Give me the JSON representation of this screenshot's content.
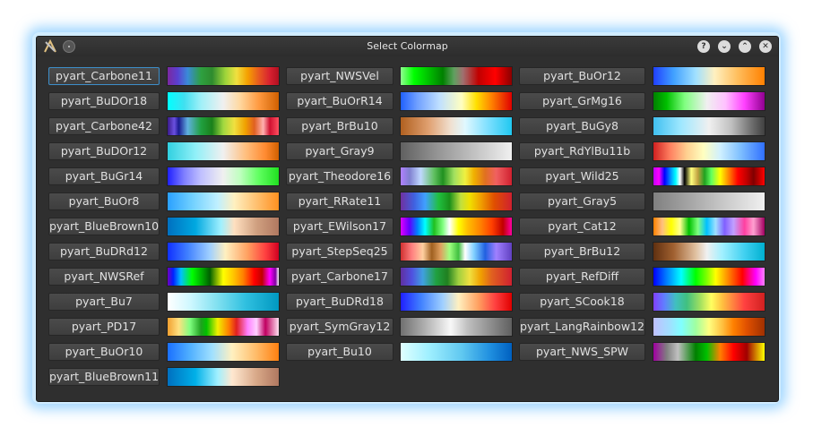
{
  "window": {
    "title": "Select Colormap",
    "buttons": {
      "help": "?",
      "minimize": "⌄",
      "maximize": "⌃",
      "close": "✕"
    }
  },
  "columns": [
    [
      {
        "name": "pyart_Carbone11",
        "gradient": "linear-gradient(90deg,#7b28a0 0%,#5a40d0 9%,#3a8ad8 18%,#2ea040 30%,#2e8b2e 40%,#9dd43a 52%,#f0e040 62%,#f5a000 72%,#e85a20 82%,#d82030 92%,#b01020 100%)"
      },
      {
        "name": "pyart_BuDOr18",
        "gradient": "linear-gradient(90deg,#00ffff 0%,#40e0f0 15%,#a0f0f8 30%,#f0f0f0 50%,#ffd8a0 65%,#ff9a40 82%,#d06000 100%)"
      },
      {
        "name": "pyart_Carbone42",
        "gradient": "linear-gradient(90deg,#3a1a8a 0%,#6a50e0 6%,#1a1a90 10%,#60b0e0 18%,#20a040 30%,#1a801a 40%,#a0d840 50%,#f0e040 60%,#f0a000 70%,#e06020 78%,#ffb0b0 86%,#d01030 92%,#ff5060 100%)"
      },
      {
        "name": "pyart_BuDOr12",
        "gradient": "linear-gradient(90deg,#30d0e0 0%,#90f0f8 25%,#f0f0f0 50%,#ffc080 70%,#ff8a30 88%,#d06000 100%)"
      },
      {
        "name": "pyart_BuGr14",
        "gradient": "linear-gradient(90deg,#2020ff 0%,#8080ff 15%,#c0c0ff 30%,#f0f0f0 50%,#c0ffc0 65%,#60ff60 82%,#20e020 100%)"
      },
      {
        "name": "pyart_BuOr8",
        "gradient": "linear-gradient(90deg,#2aa0ff 0%,#70d0ff 22%,#c0f0ff 45%,#fff0c0 60%,#ffc070 80%,#ff9020 100%)"
      },
      {
        "name": "pyart_BlueBrown10",
        "gradient": "linear-gradient(90deg,#0070c0 0%,#00a8e0 25%,#a0f0ff 48%,#ffe0c0 60%,#d0a080 80%,#b07860 100%)"
      },
      {
        "name": "pyart_BuDRd12",
        "gradient": "linear-gradient(90deg,#1030ff 0%,#4080ff 18%,#a0d0ff 38%,#fff0c0 52%,#ffa060 72%,#ff4040 88%,#d00020 100%)"
      },
      {
        "name": "pyart_NWSRef",
        "gradient": "linear-gradient(90deg,#7000c0 0%,#0020ff 5%,#00c0ff 12%,#00ff00 22%,#00a000 32%,#006000 38%,#ffff00 50%,#ffc000 60%,#ff8000 68%,#ff0000 78%,#c00000 85%,#ff00ff 92%,#8000a0 97%,#ffffff 100%)"
      },
      {
        "name": "pyart_Bu7",
        "gradient": "linear-gradient(90deg,#ffffff 0%,#d0f8ff 20%,#80e0f0 45%,#30c0e0 70%,#0098c0 100%)"
      },
      {
        "name": "pyart_PD17",
        "gradient": "linear-gradient(90deg,#f0a030 0%,#ffe080 10%,#80ff80 20%,#20a020 30%,#00c000 35%,#f0f000 45%,#ff8000 55%,#e02020 62%,#ff80ff 72%,#ffd0ff 80%,#c00060 88%,#ffe0f0 100%)"
      },
      {
        "name": "pyart_BuOr10",
        "gradient": "linear-gradient(90deg,#1a70ff 0%,#50b0ff 20%,#a0e0ff 40%,#fff0c0 58%,#ffc070 78%,#ff8010 100%)"
      },
      {
        "name": "pyart_BlueBrown11",
        "gradient": "linear-gradient(90deg,#0070c0 0%,#00b0e8 25%,#a0f0ff 45%,#ffe8d0 58%,#d8a888 80%,#b07860 100%)"
      }
    ],
    [
      {
        "name": "pyart_NWSVel",
        "gradient": "linear-gradient(90deg,#90ff90 0%,#00ff00 12%,#00c000 25%,#008000 38%,#60a060 48%,#a07070 56%,#c00000 70%,#ff0000 85%,#8a0000 100%)"
      },
      {
        "name": "pyart_BuOrR14",
        "gradient": "linear-gradient(90deg,#2060ff 0%,#70a0ff 15%,#c0e0ff 35%,#ffffc0 55%,#ffe000 68%,#ff8000 82%,#e00000 100%)"
      },
      {
        "name": "pyart_BrBu10",
        "gradient": "linear-gradient(90deg,#b06020 0%,#e0a070 25%,#f0e0d0 45%,#e0f8ff 58%,#80e0ff 78%,#20c8f0 100%)"
      },
      {
        "name": "pyart_Gray9",
        "gradient": "linear-gradient(90deg,#606060 0%,#909090 30%,#c0c0c0 65%,#f0f0f0 100%)"
      },
      {
        "name": "pyart_Theodore16",
        "gradient": "linear-gradient(90deg,#b080ff 0%,#8080d0 8%,#c0d8ff 18%,#60c060 30%,#209020 38%,#a0e060 48%,#f0f040 58%,#f0b000 66%,#e07020 76%,#f06060 86%,#d02030 100%)"
      },
      {
        "name": "pyart_RRate11",
        "gradient": "linear-gradient(90deg,#7030a0 0%,#4060e0 12%,#40a0ff 22%,#20c040 34%,#1a901a 44%,#c0e040 54%,#f0e000 62%,#f0a000 72%,#e05000 84%,#d02030 100%)"
      },
      {
        "name": "pyart_EWilson17",
        "gradient": "linear-gradient(90deg,#e000ff 0%,#6000ff 8%,#0080ff 15%,#00ffff 22%,#20c020 30%,#80ff80 38%,#ffffff 44%,#ffff00 52%,#ffc000 60%,#ff8000 72%,#ff4000 82%,#c00000 92%,#ff00a0 100%)"
      },
      {
        "name": "pyart_StepSeq25",
        "gradient": "linear-gradient(90deg,#d03030 0%,#ff8080 10%,#ffd0a0 20%,#a06020 28%,#e0a060 36%,#a0ff80 44%,#40c040 52%,#ffffff 58%,#80d0ff 66%,#2060e0 76%,#a080ff 86%,#6040c0 100%)"
      },
      {
        "name": "pyart_Carbone17",
        "gradient": "linear-gradient(90deg,#6030a0 0%,#5050e0 10%,#40a0e0 20%,#20a040 32%,#208020 42%,#a0d040 52%,#f0e040 62%,#f0a000 72%,#e06020 82%,#d02030 100%)"
      },
      {
        "name": "pyart_BuDRd18",
        "gradient": "linear-gradient(90deg,#2020ff 0%,#4080ff 18%,#a0d0ff 38%,#fff0c0 52%,#ffa060 70%,#ff4040 85%,#e00000 100%)"
      },
      {
        "name": "pyart_SymGray12",
        "gradient": "linear-gradient(90deg,#707070 0%,#b0b0b0 22%,#f8f8f8 45%,#c0c0c0 60%,#909090 80%,#606060 100%)"
      },
      {
        "name": "pyart_Bu10",
        "gradient": "linear-gradient(90deg,#e0ffff 0%,#a0f0ff 25%,#60c8f0 55%,#2090e0 80%,#0060c0 100%)"
      }
    ],
    [
      {
        "name": "pyart_BuOr12",
        "gradient": "linear-gradient(90deg,#2040ff 0%,#40a0ff 18%,#a0e0ff 38%,#fff0c0 55%,#ffc060 75%,#ff8000 100%)"
      },
      {
        "name": "pyart_GrMg16",
        "gradient": "linear-gradient(90deg,#008000 0%,#00c000 12%,#80ff80 28%,#f0f0f0 48%,#ffc0ff 65%,#ff40ff 82%,#900090 100%)"
      },
      {
        "name": "pyart_BuGy8",
        "gradient": "linear-gradient(90deg,#40c0f0 0%,#a0e8ff 25%,#f0f0f0 50%,#c0c0c0 70%,#707070 88%,#404040 100%)"
      },
      {
        "name": "pyart_RdYlBu11b",
        "gradient": "linear-gradient(90deg,#d02020 0%,#ff8060 15%,#ffd090 30%,#ffffc0 45%,#d0f0ff 60%,#80c0ff 78%,#3070ff 100%)"
      },
      {
        "name": "pyart_Wild25",
        "gradient": "linear-gradient(90deg,#c000ff 0%,#ff00ff 5%,#0000ff 10%,#00a0ff 16%,#00ffff 20%,#ffffff 24%,#000000 28%,#ffff80 34%,#c0a040 40%,#20a020 46%,#60ff60 52%,#ffff00 60%,#ff8000 68%,#ff0000 76%,#c00000 84%,#800000 90%,#ff0000 100%)"
      },
      {
        "name": "pyart_Gray5",
        "gradient": "linear-gradient(90deg,#808080 0%,#a8a8a8 35%,#d0d0d0 70%,#f0f0f0 100%)"
      },
      {
        "name": "pyart_Cat12",
        "gradient": "linear-gradient(90deg,#ff8000 0%,#ffc080 8%,#ffff00 16%,#ffff90 24%,#00c000 32%,#80ff80 40%,#00c0ff 48%,#a0e0ff 56%,#8060ff 64%,#c0a0ff 72%,#ff40a0 82%,#ffa0d0 90%,#a00060 100%)"
      },
      {
        "name": "pyart_BrBu12",
        "gradient": "linear-gradient(90deg,#603010 0%,#a06030 18%,#e0c0a0 38%,#f0f0f0 48%,#a0f0ff 62%,#40d0f0 82%,#00b0d0 100%)"
      },
      {
        "name": "pyart_RefDiff",
        "gradient": "linear-gradient(90deg,#0000ff 0%,#0080ff 12%,#00ffff 25%,#00ff00 38%,#80ff00 48%,#ffff00 56%,#ff8000 68%,#ff0000 80%,#ff00ff 92%,#ff80ff 100%)"
      },
      {
        "name": "pyart_SCook18",
        "gradient": "linear-gradient(90deg,#8040ff 0%,#6080ff 10%,#40c0c0 20%,#40c080 30%,#a0e060 42%,#ffff60 52%,#ffc040 62%,#ff8040 72%,#ff4040 82%,#d02020 100%)"
      },
      {
        "name": "pyart_LangRainbow12",
        "gradient": "linear-gradient(90deg,#c0c0ff 0%,#a0e0ff 15%,#80ffff 25%,#a0ffa0 38%,#ffff80 50%,#ffc040 62%,#ff8000 72%,#e05000 84%,#a03000 100%)"
      },
      {
        "name": "pyart_NWS_SPW",
        "gradient": "linear-gradient(90deg,#a000a0 0%,#808080 12%,#c0c0c0 22%,#008000 38%,#00c000 48%,#ff8000 60%,#ff0000 72%,#a00000 84%,#ffff00 100%)"
      }
    ]
  ]
}
